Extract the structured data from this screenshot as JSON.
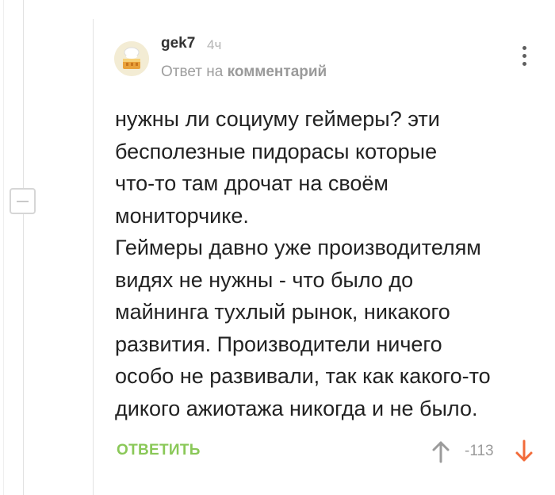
{
  "comment": {
    "author": "gek7",
    "time": "4ч",
    "reply_prefix": "Ответ на",
    "reply_target": "комментарий",
    "text_part1": "нужны ли социуму геймеры? эти\nбесполезные пидорасы которые\nчто-то там дрочат на своём\nмониторчике.",
    "text_part2": "Геймеры давно уже производителям\nвидях не нужны - что было до\nмайнинга тухлый рынок, никакого\nразвития. Производители ничего\nособо не развивали, так как какого-то\nдикого ажиотажа никогда и не было.",
    "rating": "-113"
  },
  "actions": {
    "reply_label": "ОТВЕТИТЬ"
  },
  "icons": {
    "avatar": "cake-avatar-icon",
    "more": "vertical-dots-icon",
    "collapse": "minus-icon",
    "vote_up": "arrow-up-icon",
    "vote_down": "arrow-down-icon"
  },
  "colors": {
    "reply_green": "#8ac858",
    "downvote_orange": "#f26b3a",
    "upvote_gray": "#9b9b9b",
    "muted_text": "#9e9e9e"
  }
}
